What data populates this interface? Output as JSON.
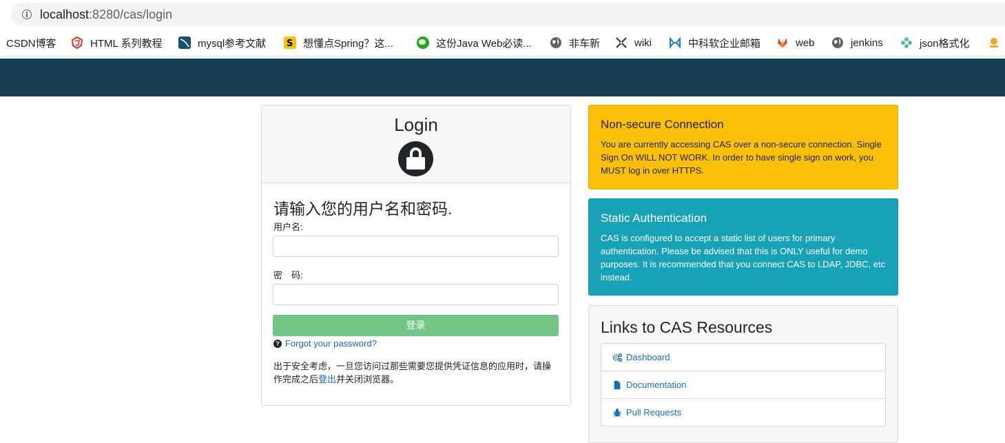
{
  "browser": {
    "url_host": "localhost",
    "url_rest": ":8280/cas/login",
    "bookmarks": [
      {
        "label": "CSDN博客",
        "icon": "none"
      },
      {
        "label": "HTML 系列教程",
        "icon": "html-icon"
      },
      {
        "label": "mysql参考文献",
        "icon": "mysql-icon"
      },
      {
        "label": "想懂点Spring？这...",
        "icon": "spring-icon"
      },
      {
        "label": "这份Java Web必读...",
        "icon": "wechat-icon"
      },
      {
        "label": "非车新",
        "icon": "globe-icon"
      },
      {
        "label": "wiki",
        "icon": "wiki-icon"
      },
      {
        "label": "中科软企业邮箱",
        "icon": "mail-icon"
      },
      {
        "label": "web",
        "icon": "gitlab-icon"
      },
      {
        "label": "jenkins",
        "icon": "globe-icon"
      },
      {
        "label": "json格式化",
        "icon": "json-icon"
      }
    ]
  },
  "login": {
    "title": "Login",
    "form_title": "请输入您的用户名和密码.",
    "username_label": "用户名:",
    "username_value": "",
    "password_label": "密　码:",
    "password_value": "",
    "submit_label": "登录",
    "forgot_label": "Forgot your password?",
    "notice_prefix": "出于安全考虑，一旦您访问过那些需要您提供凭证信息的应用时，请操作完成之后",
    "notice_link": "登出",
    "notice_suffix": "并关闭浏览器。"
  },
  "alerts": {
    "warning": {
      "title": "Non-secure Connection",
      "body": "You are currently accessing CAS over a non-secure connection. Single Sign On WILL NOT WORK. In order to have single sign on work, you MUST log in over HTTPS."
    },
    "info": {
      "title": "Static Authentication",
      "body": "CAS is configured to accept a static list of users for primary authentication. Please be advised that this is ONLY useful for demo purposes. It is recommended that you connect CAS to LDAP, JDBC, etc instead."
    }
  },
  "resources": {
    "title": "Links to CAS Resources",
    "items": [
      {
        "label": "Dashboard",
        "icon": "gears-icon"
      },
      {
        "label": "Documentation",
        "icon": "file-icon"
      },
      {
        "label": "Pull Requests",
        "icon": "bug-icon"
      }
    ]
  },
  "colors": {
    "header": "#153e50",
    "warning": "#fcc00b",
    "info": "#17a2b8",
    "submit": "#74c687",
    "link": "#1a6db0"
  }
}
